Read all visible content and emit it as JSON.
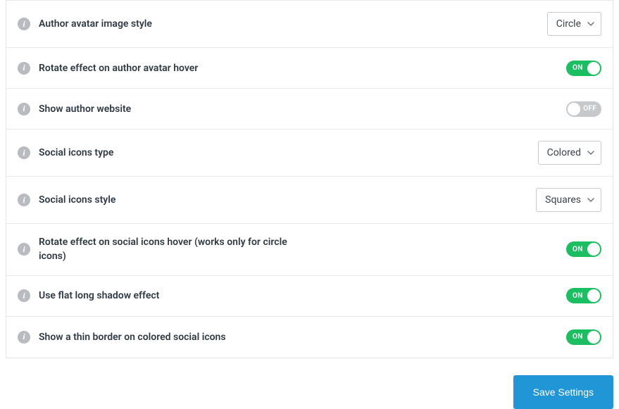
{
  "settings": [
    {
      "id": "author-avatar-style",
      "label": "Author avatar image style",
      "type": "select",
      "value": "Circle"
    },
    {
      "id": "rotate-avatar-hover",
      "label": "Rotate effect on author avatar hover",
      "type": "toggle",
      "value": "ON"
    },
    {
      "id": "show-author-website",
      "label": "Show author website",
      "type": "toggle",
      "value": "OFF"
    },
    {
      "id": "social-icons-type",
      "label": "Social icons type",
      "type": "select",
      "value": "Colored"
    },
    {
      "id": "social-icons-style",
      "label": "Social icons style",
      "type": "select",
      "value": "Squares"
    },
    {
      "id": "rotate-social-hover",
      "label": "Rotate effect on social icons hover (works only for circle icons)",
      "type": "toggle",
      "value": "ON",
      "multiline": true
    },
    {
      "id": "flat-long-shadow",
      "label": "Use flat long shadow effect",
      "type": "toggle",
      "value": "ON"
    },
    {
      "id": "thin-border-colored",
      "label": "Show a thin border on colored social icons",
      "type": "toggle",
      "value": "ON"
    }
  ],
  "ui": {
    "info_glyph": "i",
    "toggle_on": "ON",
    "toggle_off": "OFF",
    "save_label": "Save Settings"
  }
}
